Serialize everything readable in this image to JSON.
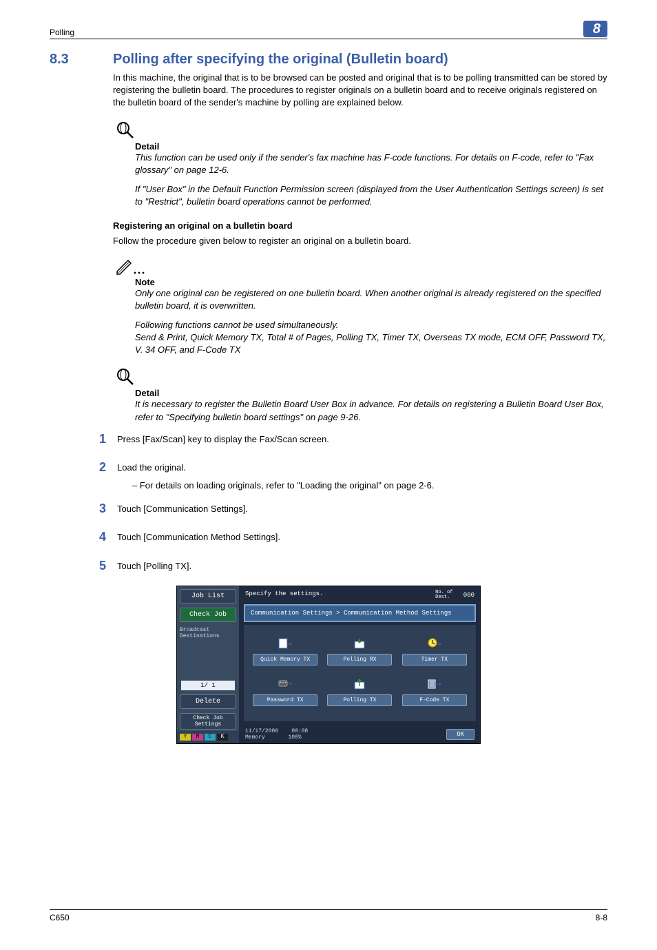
{
  "header": {
    "left": "Polling",
    "chapter": "8"
  },
  "section": {
    "num": "8.3",
    "title": "Polling after specifying the original (Bulletin board)"
  },
  "intro": "In this machine, the original that is to be browsed can be posted and original that is to be polling transmitted can be stored by registering the bulletin board. The procedures to register originals on a bulletin board and to receive originals registered on the bulletin board of the sender's machine by polling are explained below.",
  "detail1": {
    "title": "Detail",
    "p1": "This function can be used only if the sender's fax machine has F-code functions. For details on F-code, refer to \"Fax glossary\" on page 12-6.",
    "p2": "If \"User Box\" in the Default Function Permission screen (displayed from the User Authentication Settings screen) is set to \"Restrict\", bulletin board operations cannot be performed."
  },
  "subheading": "Registering an original on a bulletin board",
  "subintro": "Follow the procedure given below to register an original on a bulletin board.",
  "note": {
    "title": "Note",
    "p1": "Only one original can be registered on one bulletin board. When another original is already registered on the specified bulletin board, it is overwritten.",
    "p2": "Following functions cannot be used simultaneously.",
    "p3": "Send & Print, Quick Memory TX, Total # of Pages, Polling TX, Timer TX, Overseas TX mode, ECM OFF, Password TX, V. 34 OFF, and F-Code TX"
  },
  "detail2": {
    "title": "Detail",
    "p1": "It is necessary to register the Bulletin Board User Box in advance. For details on registering a Bulletin Board User Box, refer to \"Specifying bulletin board settings\" on page 9-26."
  },
  "steps": {
    "s1": "Press [Fax/Scan] key to display the Fax/Scan screen.",
    "s2": "Load the original.",
    "s2b": "–   For details on loading originals, refer to \"Loading the original\" on page 2-6.",
    "s3": "Touch [Communication Settings].",
    "s4": "Touch [Communication Method Settings].",
    "s5": "Touch [Polling TX]."
  },
  "screenshot": {
    "job_list": "Job List",
    "check_job": "Check Job",
    "broadcast": "Broadcast\nDestinations",
    "page": "1/  1",
    "delete": "Delete",
    "check_settings": "Check Job\nSettings",
    "top": "Specify the settings.",
    "dest_label": "No. of\nDest.",
    "dest_val": "000",
    "breadcrumb": "Communication Settings > Communication Method Settings",
    "buttons": {
      "b1": "Quick Memory TX",
      "b2": "Polling RX",
      "b3": "Timer TX",
      "b4": "Password TX",
      "b5": "Polling TX",
      "b6": "F-Code TX"
    },
    "date": "11/17/2006",
    "time": "00:08",
    "mem": "Memory",
    "mem_val": "100%",
    "ok": "OK"
  },
  "footer": {
    "left": "C650",
    "right": "8-8"
  }
}
